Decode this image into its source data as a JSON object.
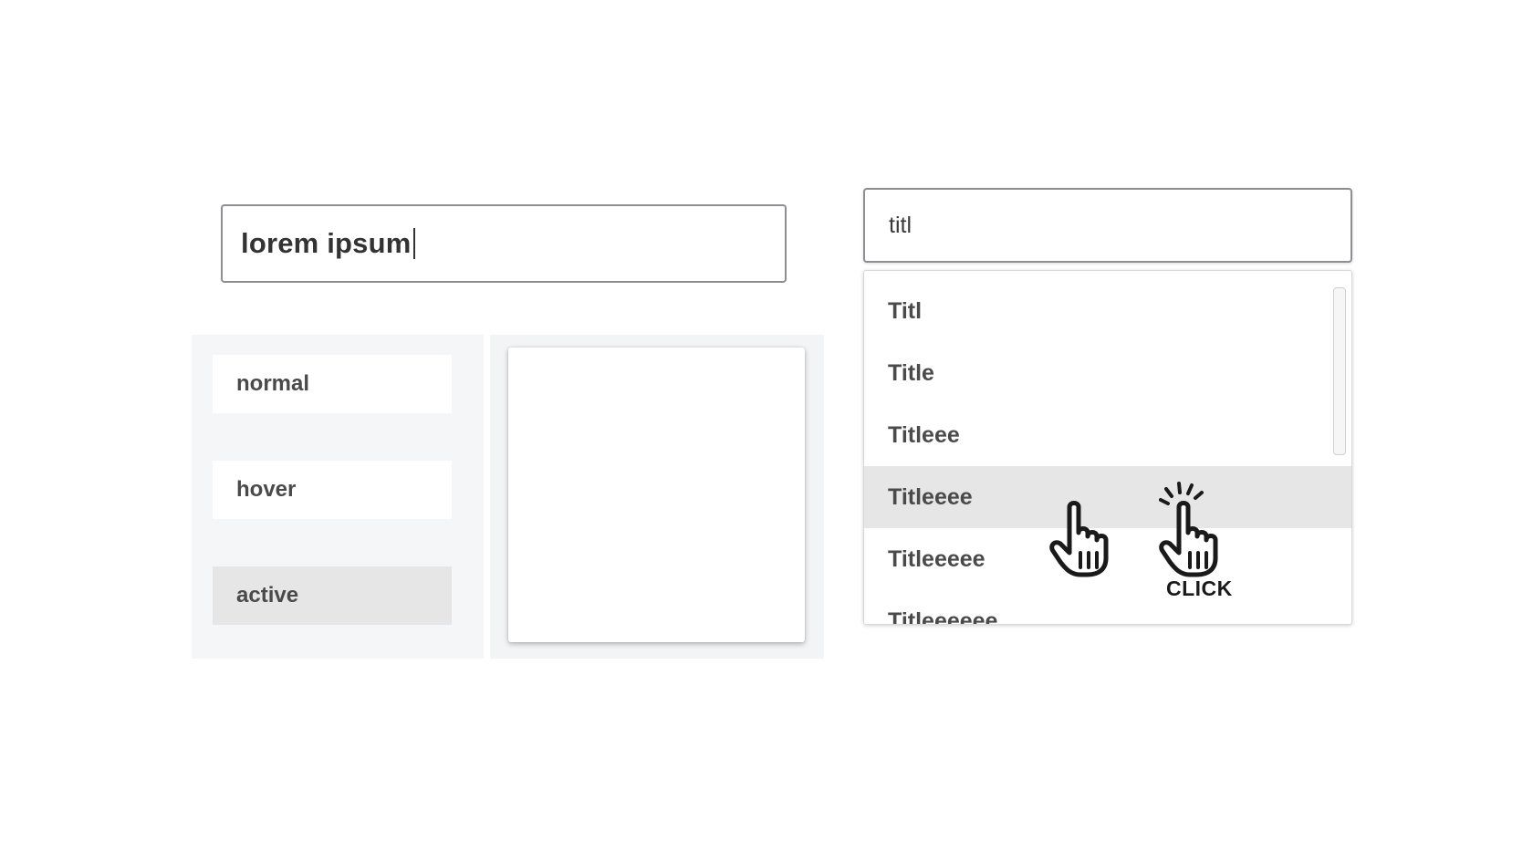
{
  "text_field": {
    "value": "lorem ipsum"
  },
  "states": [
    {
      "label": "normal"
    },
    {
      "label": "hover"
    },
    {
      "label": "active"
    }
  ],
  "combobox": {
    "query": "titl",
    "options": [
      {
        "label": "Titl"
      },
      {
        "label": "Title"
      },
      {
        "label": "Titleee"
      },
      {
        "label": "Titleeee"
      },
      {
        "label": "Titleeeee"
      },
      {
        "label": "Titleeeeee"
      }
    ],
    "highlighted_option": "Titleeee"
  },
  "cursors": {
    "hover_icon": "hand-pointer-icon",
    "click_icon": "hand-pointer-click-icon",
    "click_label": "CLICK"
  },
  "colors": {
    "highlight": "#e6e6e6",
    "panel_background": "#f5f6f8",
    "border": "#8d8e92"
  }
}
